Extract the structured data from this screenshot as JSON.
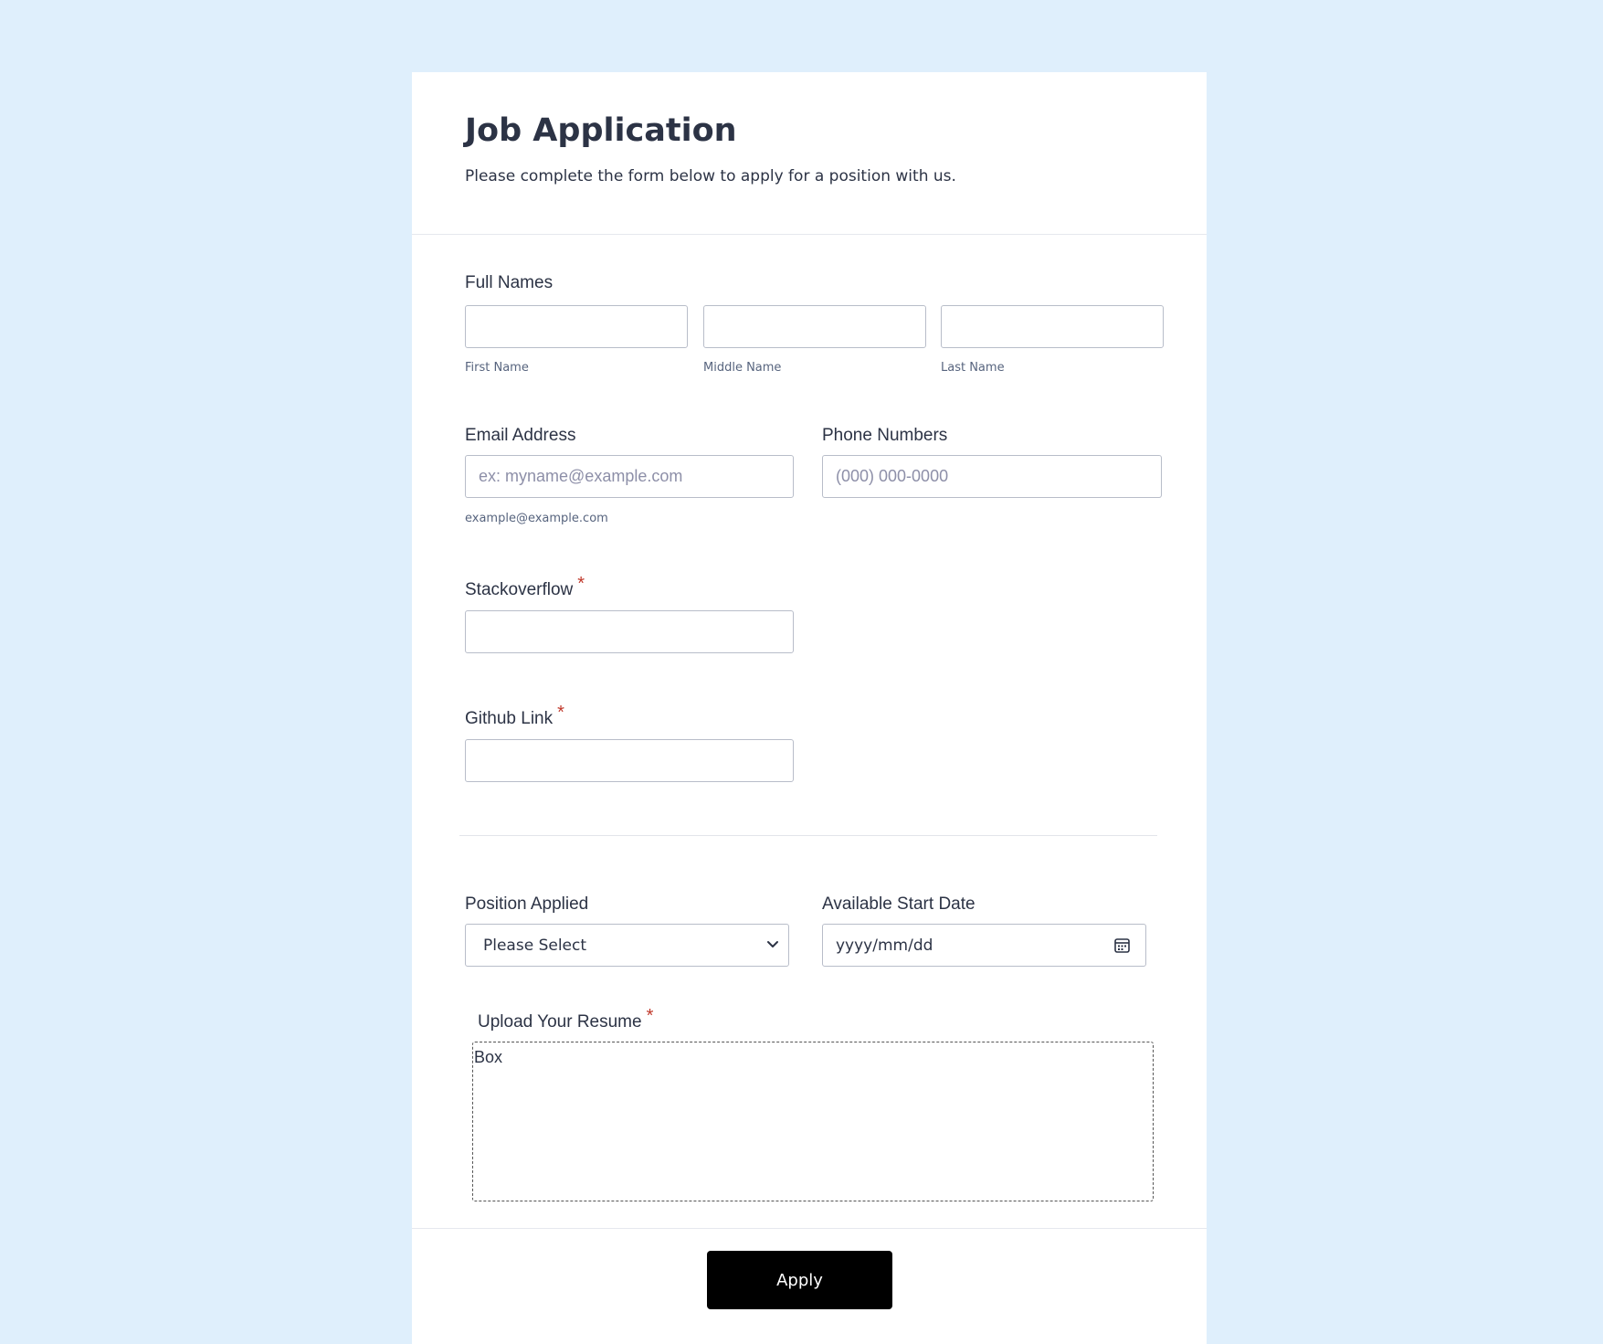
{
  "header": {
    "title": "Job Application",
    "subtitle": "Please complete the form below to apply for a position with us."
  },
  "full_names": {
    "label": "Full Names",
    "first": {
      "value": "",
      "sublabel": "First Name"
    },
    "middle": {
      "value": "",
      "sublabel": "Middle Name"
    },
    "last": {
      "value": "",
      "sublabel": "Last Name"
    }
  },
  "email": {
    "label": "Email Address",
    "value": "",
    "placeholder": "ex: myname@example.com",
    "sublabel": "example@example.com"
  },
  "phone": {
    "label": "Phone Numbers",
    "value": "",
    "placeholder": "(000) 000-0000"
  },
  "stackoverflow": {
    "label": "Stackoverflow",
    "required_mark": "*",
    "value": ""
  },
  "github": {
    "label": "Github Link",
    "required_mark": "*",
    "value": ""
  },
  "position": {
    "label": "Position Applied",
    "selected": "Please Select"
  },
  "start_date": {
    "label": "Available Start Date",
    "placeholder": "yyyy/mm/dd"
  },
  "resume": {
    "label": "Upload Your Resume",
    "required_mark": "*",
    "box_text": "Box"
  },
  "footer": {
    "apply_label": "Apply"
  },
  "colors": {
    "background": "#dfeffc",
    "card": "#ffffff",
    "required": "#c0392b",
    "button": "#000000"
  },
  "icons": {
    "select": "chevron-down-icon",
    "date": "calendar-icon"
  }
}
